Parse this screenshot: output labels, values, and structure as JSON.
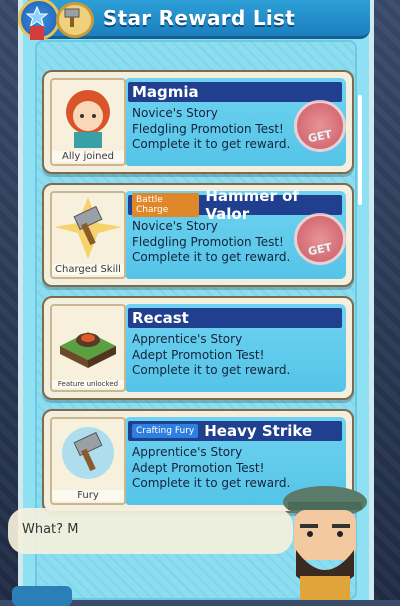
{
  "header": {
    "title": "Star Reward List"
  },
  "cards": [
    {
      "name": "Magmia",
      "tag": "",
      "portrait_label": "Ally joined",
      "lines": [
        "Novice's Story",
        "Fledgling Promotion Test!",
        "Complete it to get reward."
      ],
      "button": "GET"
    },
    {
      "name": "Hammer of Valor",
      "tag": "Battle Charge",
      "portrait_label": "Charged Skill",
      "lines": [
        "Novice's Story",
        "Fledgling Promotion Test!",
        "Complete it to get reward."
      ],
      "button": "GET"
    },
    {
      "name": "Recast",
      "tag": "",
      "portrait_label": "Feature unlocked",
      "lines": [
        "Apprentice's Story",
        "Adept Promotion Test!",
        "Complete it to get reward."
      ],
      "button": ""
    },
    {
      "name": "Heavy Strike",
      "tag": "Crafting Fury",
      "portrait_label": "Fury",
      "lines": [
        "Apprentice's Story",
        "Adept Promotion Test!",
        "Complete it to get reward."
      ],
      "button": ""
    }
  ],
  "speech": {
    "text": "What? M"
  },
  "colors": {
    "title_bar": "#213f8f",
    "get_button": "#e0484d",
    "panel": "#8fe0f2"
  }
}
